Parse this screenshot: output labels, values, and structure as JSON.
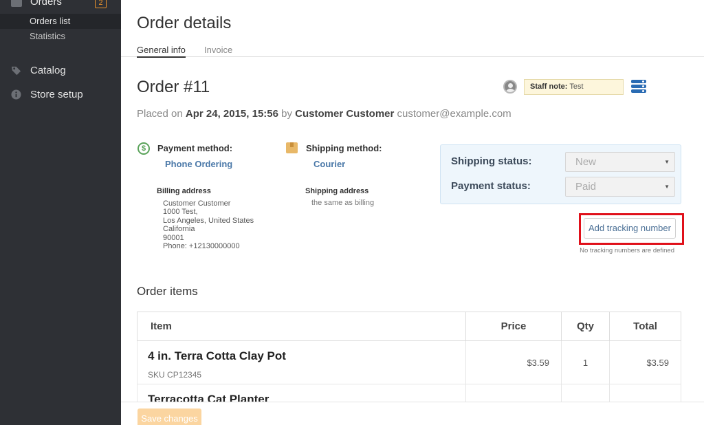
{
  "sidebar": {
    "orders_label": "Orders",
    "orders_badge": "2",
    "sub_items": [
      "Orders list",
      "Statistics"
    ],
    "catalog_label": "Catalog",
    "store_setup_label": "Store setup"
  },
  "page": {
    "title": "Order details",
    "tabs": [
      "General info",
      "Invoice"
    ]
  },
  "order": {
    "title": "Order #11",
    "placed_prefix": "Placed on",
    "placed_date": "Apr 24, 2015, 15:56",
    "placed_by": "by",
    "customer_name": "Customer Customer",
    "customer_email": "customer@example.com",
    "staff_note_label": "Staff note:",
    "staff_note_value": "Test"
  },
  "payment": {
    "label": "Payment method:",
    "value": "Phone Ordering"
  },
  "shipping": {
    "label": "Shipping method:",
    "value": "Courier"
  },
  "billing_address": {
    "title": "Billing address",
    "lines": [
      "Customer Customer",
      "1000 Test,",
      "Los Angeles, United States",
      "California",
      "90001",
      "Phone: +12130000000"
    ]
  },
  "shipping_address": {
    "title": "Shipping address",
    "value": "the same as billing"
  },
  "status": {
    "shipping_label": "Shipping status:",
    "shipping_value": "New",
    "payment_label": "Payment status:",
    "payment_value": "Paid"
  },
  "tracking": {
    "button_label": "Add tracking number",
    "empty_text": "No tracking numbers are defined"
  },
  "items": {
    "title": "Order items",
    "columns": [
      "Item",
      "Price",
      "Qty",
      "Total"
    ],
    "rows": [
      {
        "name": "4 in. Terra Cotta Clay Pot",
        "sku_label": "SKU",
        "sku": "CP12345",
        "price": "$3.59",
        "qty": "1",
        "total": "$3.59"
      },
      {
        "name": "Terracotta Cat Planter"
      }
    ]
  },
  "footer": {
    "save_label": "Save changes"
  },
  "colors": {
    "sidebar_bg": "#2e3035",
    "accent_orange": "#e8922c",
    "link_blue": "#4a78a8",
    "highlight_red": "#e0101a"
  }
}
